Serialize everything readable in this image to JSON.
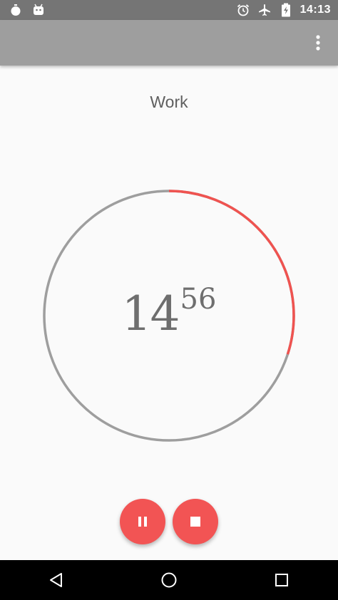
{
  "status_bar": {
    "time": "14:13",
    "left_icons": [
      "stopwatch-icon",
      "android-icon"
    ],
    "right_icons": [
      "alarm-icon",
      "airplane-mode-icon",
      "battery-charging-icon"
    ]
  },
  "app_bar": {
    "overflow_icon": "more-vert-icon"
  },
  "session": {
    "label": "Work"
  },
  "timer": {
    "minutes": "14",
    "seconds": "56",
    "remaining_fraction": 0.3,
    "colors": {
      "track": "#9e9e9e",
      "progress": "#ef5350"
    }
  },
  "controls": {
    "pause_icon": "pause-icon",
    "stop_icon": "stop-icon",
    "fab_color": "#f25454"
  },
  "nav_bar": {
    "back_icon": "back-triangle-icon",
    "home_icon": "home-circle-icon",
    "recents_icon": "recents-square-icon"
  }
}
